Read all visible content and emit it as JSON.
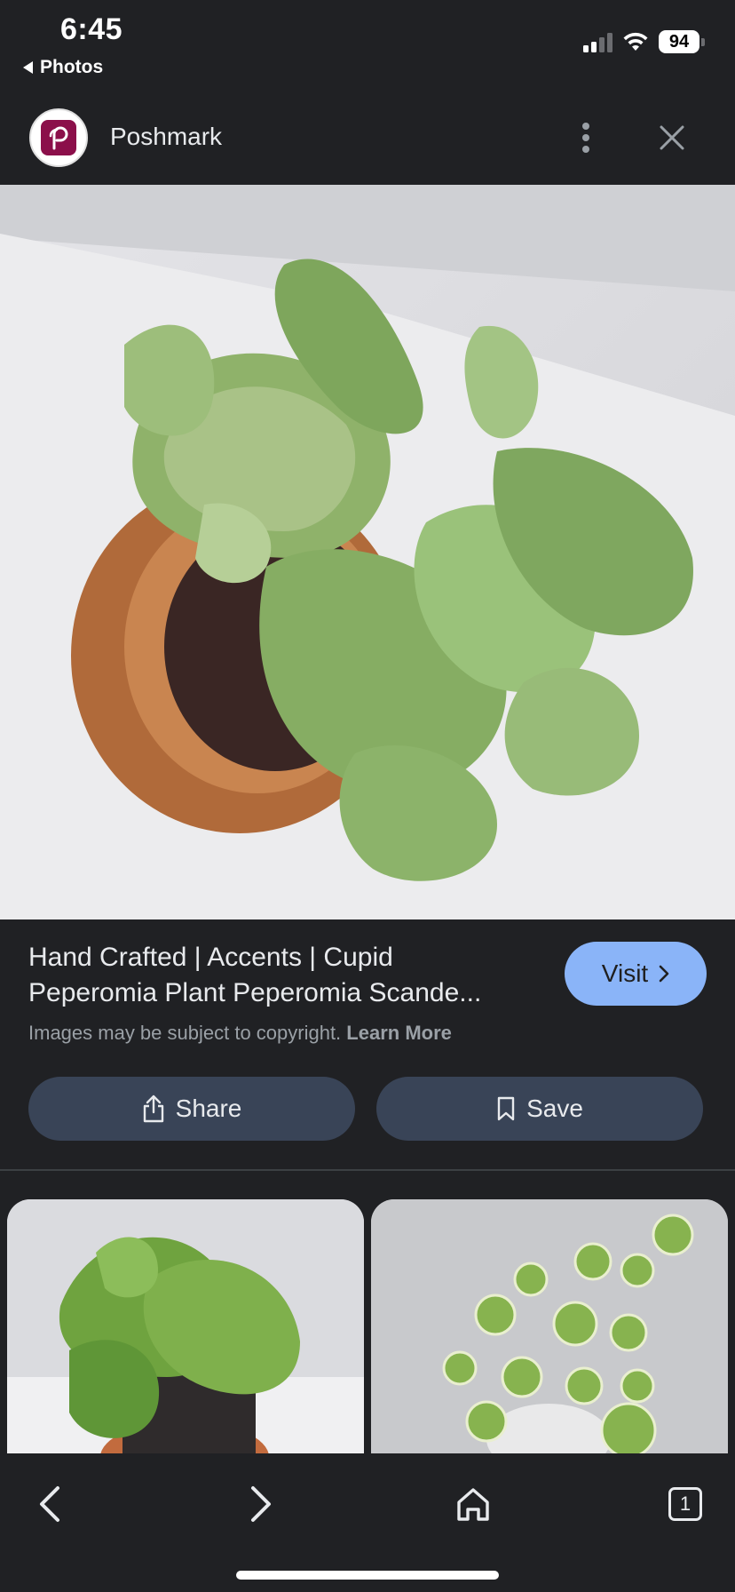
{
  "status_bar": {
    "time": "6:45",
    "back_app": "Photos",
    "battery": "94"
  },
  "header": {
    "site_name": "Poshmark",
    "logo_letter": "P",
    "brand_color": "#8b0f4a"
  },
  "result": {
    "title_line1": "Hand Crafted | Accents | Cupid",
    "title_line2": "Peperomia Plant Peperomia Scande...",
    "copyright_text": "Images may be subject to copyright.",
    "learn_more": "Learn More",
    "visit_label": "Visit"
  },
  "actions": {
    "share_label": "Share",
    "save_label": "Save"
  },
  "bottom_nav": {
    "tab_count": "1"
  },
  "colors": {
    "background": "#202124",
    "visit_button": "#8ab4f8",
    "action_button": "#394457"
  }
}
